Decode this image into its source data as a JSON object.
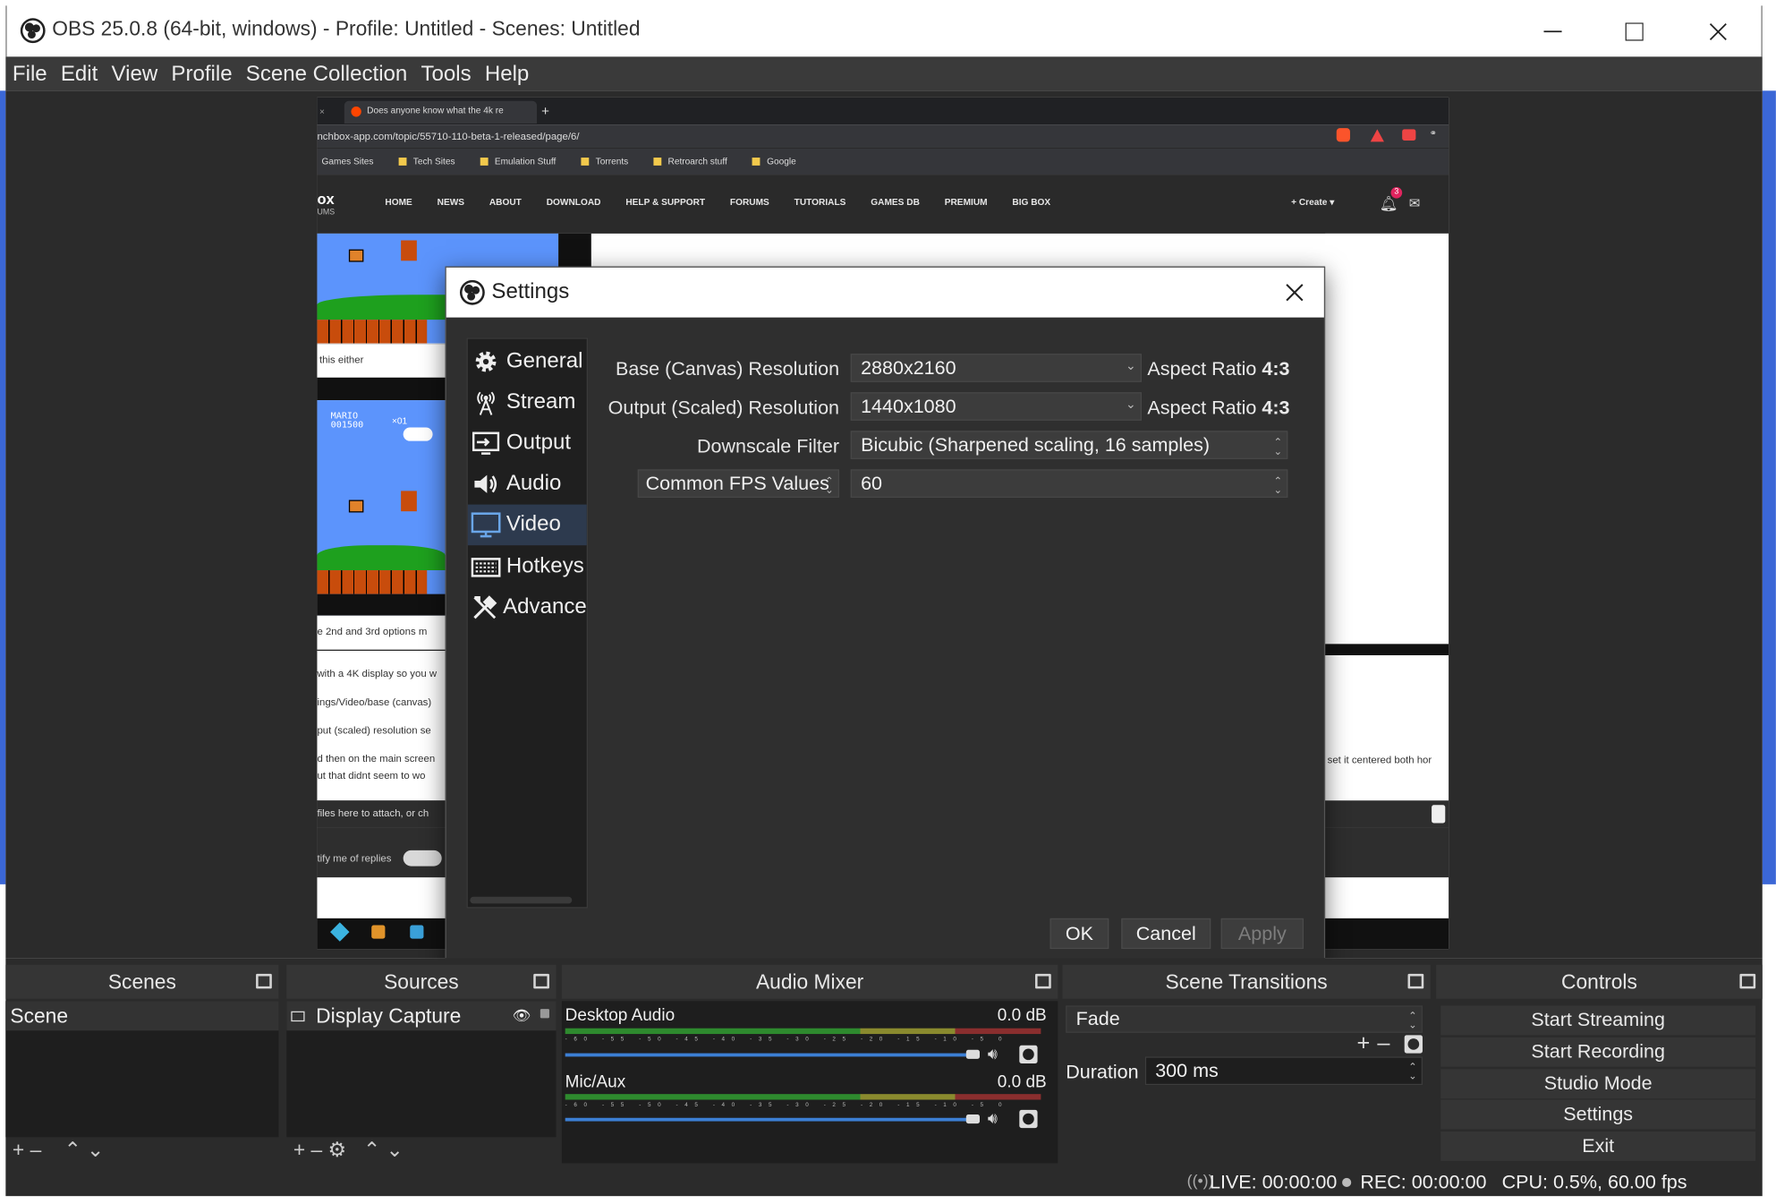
{
  "window": {
    "title": "OBS 25.0.8 (64-bit, windows) - Profile: Untitled - Scenes: Untitled",
    "controls": [
      "minimize",
      "maximize",
      "close"
    ]
  },
  "menu": [
    "File",
    "Edit",
    "View",
    "Profile",
    "Scene Collection",
    "Tools",
    "Help"
  ],
  "preview": {
    "tab_title": "Does anyone know what the 4k re",
    "url": "nchbox-app.com/topic/55710-110-beta-1-released/page/6/",
    "bookmarks": [
      "Games Sites",
      "Tech Sites",
      "Emulation Stuff",
      "Torrents",
      "Retroarch stuff",
      "Google"
    ],
    "site_logo": "ox",
    "site_logo_sub": "UMS",
    "nav": [
      "HOME",
      "NEWS",
      "ABOUT",
      "DOWNLOAD",
      "HELP & SUPPORT",
      "FORUMS",
      "TUTORIALS",
      "GAMES DB",
      "PREMIUM",
      "BIG BOX"
    ],
    "create_label": "+ Create ▾",
    "notif_count": "3",
    "snippets": [
      "this either",
      "e 2nd and 3rd options m",
      "with a 4K display so you w",
      "ings/Video/base (canvas)",
      "put (scaled) resolution se",
      "d then on the main screen",
      "ut that didnt seem to wo",
      "files here to attach, or ch",
      "tify me of replies"
    ],
    "right_snippet": "set it centered both hor",
    "mario_score": "MARIO\n001500",
    "mario_coins": "×01"
  },
  "settings": {
    "title": "Settings",
    "sidebar": [
      {
        "label": "General",
        "icon": "gear-icon"
      },
      {
        "label": "Stream",
        "icon": "antenna-icon"
      },
      {
        "label": "Output",
        "icon": "output-icon"
      },
      {
        "label": "Audio",
        "icon": "speaker-icon"
      },
      {
        "label": "Video",
        "icon": "monitor-icon"
      },
      {
        "label": "Hotkeys",
        "icon": "keyboard-icon"
      },
      {
        "label": "Advance",
        "icon": "tools-icon"
      }
    ],
    "active": "Video",
    "fields": {
      "base_label": "Base (Canvas) Resolution",
      "base_value": "2880x2160",
      "base_aspect_prefix": "Aspect Ratio",
      "base_aspect": "4:3",
      "output_label": "Output (Scaled) Resolution",
      "output_value": "1440x1080",
      "output_aspect_prefix": "Aspect Ratio",
      "output_aspect": "4:3",
      "filter_label": "Downscale Filter",
      "filter_value": "Bicubic (Sharpened scaling, 16 samples)",
      "fps_label": "Common FPS Values",
      "fps_value": "60"
    },
    "buttons": {
      "ok": "OK",
      "cancel": "Cancel",
      "apply": "Apply"
    }
  },
  "docks": {
    "scenes": {
      "title": "Scenes",
      "items": [
        "Scene"
      ]
    },
    "sources": {
      "title": "Sources",
      "items": [
        "Display Capture"
      ]
    },
    "mixer": {
      "title": "Audio Mixer",
      "channels": [
        {
          "name": "Desktop Audio",
          "level": "0.0 dB"
        },
        {
          "name": "Mic/Aux",
          "level": "0.0 dB"
        }
      ],
      "ticks": "-60 -55 -50 -45 -40 -35 -30 -25 -20 -15 -10 -5 0"
    },
    "transitions": {
      "title": "Scene Transitions",
      "transition": "Fade",
      "duration_label": "Duration",
      "duration_value": "300 ms"
    },
    "controls": {
      "title": "Controls",
      "buttons": [
        "Start Streaming",
        "Start Recording",
        "Studio Mode",
        "Settings",
        "Exit"
      ]
    }
  },
  "status": {
    "live": "LIVE: 00:00:00",
    "rec": "REC: 00:00:00",
    "cpu": "CPU: 0.5%, 60.00 fps"
  },
  "colors": {
    "accent": "#3c7fd4",
    "active_side": "#2d3a4e",
    "dark": "#2b2b2b"
  }
}
